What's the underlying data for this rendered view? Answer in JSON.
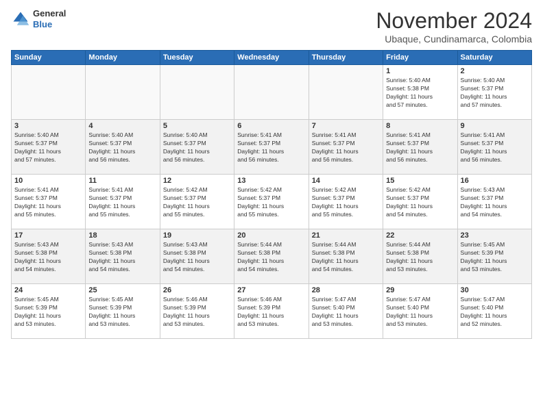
{
  "header": {
    "logo_line1": "General",
    "logo_line2": "Blue",
    "month": "November 2024",
    "location": "Ubaque, Cundinamarca, Colombia"
  },
  "days_of_week": [
    "Sunday",
    "Monday",
    "Tuesday",
    "Wednesday",
    "Thursday",
    "Friday",
    "Saturday"
  ],
  "weeks": [
    [
      {
        "day": "",
        "info": ""
      },
      {
        "day": "",
        "info": ""
      },
      {
        "day": "",
        "info": ""
      },
      {
        "day": "",
        "info": ""
      },
      {
        "day": "",
        "info": ""
      },
      {
        "day": "1",
        "info": "Sunrise: 5:40 AM\nSunset: 5:38 PM\nDaylight: 11 hours\nand 57 minutes."
      },
      {
        "day": "2",
        "info": "Sunrise: 5:40 AM\nSunset: 5:37 PM\nDaylight: 11 hours\nand 57 minutes."
      }
    ],
    [
      {
        "day": "3",
        "info": "Sunrise: 5:40 AM\nSunset: 5:37 PM\nDaylight: 11 hours\nand 57 minutes."
      },
      {
        "day": "4",
        "info": "Sunrise: 5:40 AM\nSunset: 5:37 PM\nDaylight: 11 hours\nand 56 minutes."
      },
      {
        "day": "5",
        "info": "Sunrise: 5:40 AM\nSunset: 5:37 PM\nDaylight: 11 hours\nand 56 minutes."
      },
      {
        "day": "6",
        "info": "Sunrise: 5:41 AM\nSunset: 5:37 PM\nDaylight: 11 hours\nand 56 minutes."
      },
      {
        "day": "7",
        "info": "Sunrise: 5:41 AM\nSunset: 5:37 PM\nDaylight: 11 hours\nand 56 minutes."
      },
      {
        "day": "8",
        "info": "Sunrise: 5:41 AM\nSunset: 5:37 PM\nDaylight: 11 hours\nand 56 minutes."
      },
      {
        "day": "9",
        "info": "Sunrise: 5:41 AM\nSunset: 5:37 PM\nDaylight: 11 hours\nand 56 minutes."
      }
    ],
    [
      {
        "day": "10",
        "info": "Sunrise: 5:41 AM\nSunset: 5:37 PM\nDaylight: 11 hours\nand 55 minutes."
      },
      {
        "day": "11",
        "info": "Sunrise: 5:41 AM\nSunset: 5:37 PM\nDaylight: 11 hours\nand 55 minutes."
      },
      {
        "day": "12",
        "info": "Sunrise: 5:42 AM\nSunset: 5:37 PM\nDaylight: 11 hours\nand 55 minutes."
      },
      {
        "day": "13",
        "info": "Sunrise: 5:42 AM\nSunset: 5:37 PM\nDaylight: 11 hours\nand 55 minutes."
      },
      {
        "day": "14",
        "info": "Sunrise: 5:42 AM\nSunset: 5:37 PM\nDaylight: 11 hours\nand 55 minutes."
      },
      {
        "day": "15",
        "info": "Sunrise: 5:42 AM\nSunset: 5:37 PM\nDaylight: 11 hours\nand 54 minutes."
      },
      {
        "day": "16",
        "info": "Sunrise: 5:43 AM\nSunset: 5:37 PM\nDaylight: 11 hours\nand 54 minutes."
      }
    ],
    [
      {
        "day": "17",
        "info": "Sunrise: 5:43 AM\nSunset: 5:38 PM\nDaylight: 11 hours\nand 54 minutes."
      },
      {
        "day": "18",
        "info": "Sunrise: 5:43 AM\nSunset: 5:38 PM\nDaylight: 11 hours\nand 54 minutes."
      },
      {
        "day": "19",
        "info": "Sunrise: 5:43 AM\nSunset: 5:38 PM\nDaylight: 11 hours\nand 54 minutes."
      },
      {
        "day": "20",
        "info": "Sunrise: 5:44 AM\nSunset: 5:38 PM\nDaylight: 11 hours\nand 54 minutes."
      },
      {
        "day": "21",
        "info": "Sunrise: 5:44 AM\nSunset: 5:38 PM\nDaylight: 11 hours\nand 54 minutes."
      },
      {
        "day": "22",
        "info": "Sunrise: 5:44 AM\nSunset: 5:38 PM\nDaylight: 11 hours\nand 53 minutes."
      },
      {
        "day": "23",
        "info": "Sunrise: 5:45 AM\nSunset: 5:39 PM\nDaylight: 11 hours\nand 53 minutes."
      }
    ],
    [
      {
        "day": "24",
        "info": "Sunrise: 5:45 AM\nSunset: 5:39 PM\nDaylight: 11 hours\nand 53 minutes."
      },
      {
        "day": "25",
        "info": "Sunrise: 5:45 AM\nSunset: 5:39 PM\nDaylight: 11 hours\nand 53 minutes."
      },
      {
        "day": "26",
        "info": "Sunrise: 5:46 AM\nSunset: 5:39 PM\nDaylight: 11 hours\nand 53 minutes."
      },
      {
        "day": "27",
        "info": "Sunrise: 5:46 AM\nSunset: 5:39 PM\nDaylight: 11 hours\nand 53 minutes."
      },
      {
        "day": "28",
        "info": "Sunrise: 5:47 AM\nSunset: 5:40 PM\nDaylight: 11 hours\nand 53 minutes."
      },
      {
        "day": "29",
        "info": "Sunrise: 5:47 AM\nSunset: 5:40 PM\nDaylight: 11 hours\nand 53 minutes."
      },
      {
        "day": "30",
        "info": "Sunrise: 5:47 AM\nSunset: 5:40 PM\nDaylight: 11 hours\nand 52 minutes."
      }
    ]
  ]
}
